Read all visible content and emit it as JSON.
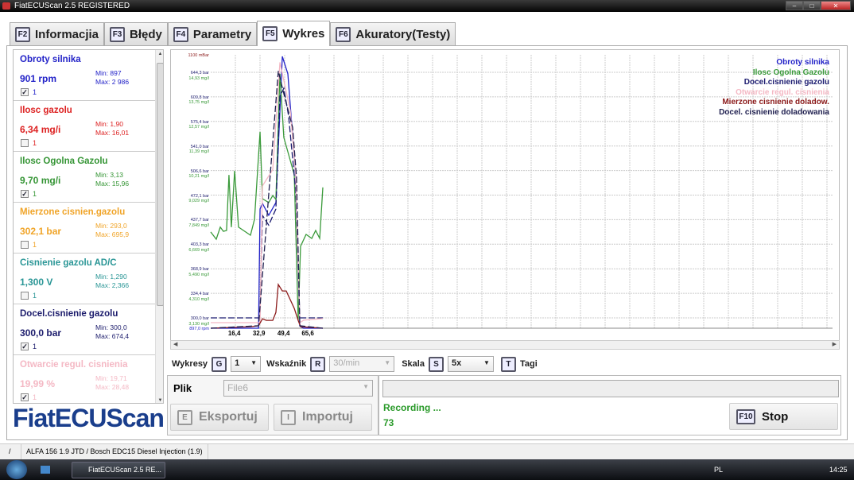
{
  "window": {
    "title": "FiatECUScan 2.5 REGISTERED"
  },
  "tabs": [
    {
      "key": "F2",
      "label": "Informacjia",
      "active": false
    },
    {
      "key": "F3",
      "label": "Błędy",
      "active": false
    },
    {
      "key": "F4",
      "label": "Parametry",
      "active": false
    },
    {
      "key": "F5",
      "label": "Wykres",
      "active": true
    },
    {
      "key": "F6",
      "label": "Akuratory(Testy)",
      "active": false
    }
  ],
  "params": [
    {
      "name": "Obroty silnika",
      "value": "901 rpm",
      "min": "Min: 897",
      "max": "Max: 2 986",
      "checked": true,
      "idx": "1",
      "color": "#2323c8"
    },
    {
      "name": "Ilosc gazolu",
      "value": "6,34 mg/i",
      "min": "Min: 1,90",
      "max": "Max: 16,01",
      "checked": false,
      "idx": "1",
      "color": "#dd2222"
    },
    {
      "name": "Ilosc Ogolna Gazolu",
      "value": "9,70 mg/i",
      "min": "Min: 3,13",
      "max": "Max: 15,96",
      "checked": true,
      "idx": "1",
      "color": "#359535"
    },
    {
      "name": "Mierzone cisnien.gazolu",
      "value": "302,1 bar",
      "min": "Min: 293,0",
      "max": "Max: 695,9",
      "checked": false,
      "idx": "1",
      "color": "#f0a428"
    },
    {
      "name": "Cisnienie gazolu AD/C",
      "value": "1,300 V",
      "min": "Min: 1,290",
      "max": "Max: 2,366",
      "checked": false,
      "idx": "1",
      "color": "#2a9696"
    },
    {
      "name": "Docel.cisnienie gazolu",
      "value": "300,0 bar",
      "min": "Min: 300,0",
      "max": "Max: 674,4",
      "checked": true,
      "idx": "1",
      "color": "#1c1c6c"
    },
    {
      "name": "Otwarcie regul. cisnienia",
      "value": "19,99 %",
      "min": "Min: 19,71",
      "max": "Max: 28,48",
      "checked": true,
      "idx": "1",
      "color": "#f4b8c4"
    }
  ],
  "logo": "FiatECUScan",
  "chart_data": {
    "type": "line",
    "xlim": [
      0,
      415
    ],
    "x_ticks": [
      "16,4",
      "32,9",
      "49,4",
      "65,6"
    ],
    "x_tick_values": [
      16.4,
      32.9,
      49.4,
      65.6
    ],
    "grid": true,
    "legend_position": "top-right",
    "y_labels": [
      [
        "1100 mBar"
      ],
      [
        "644,3 bar",
        "14,93 mg/l"
      ],
      [
        "609,8 bar",
        "13,75 mg/l"
      ],
      [
        "575,4 bar",
        "12,57 mg/l"
      ],
      [
        "541,0 bar",
        "11,39 mg/l"
      ],
      [
        "506,6 bar",
        "10,21 mg/l"
      ],
      [
        "472,1 bar",
        "9,029 mg/l"
      ],
      [
        "437,7 bar",
        "7,849 mg/l"
      ],
      [
        "403,3 bar",
        "6,669 mg/l"
      ],
      [
        "368,9 bar",
        "5,490 mg/l"
      ],
      [
        "334,4 bar",
        "4,310 mg/l"
      ],
      [
        "300,0 bar",
        "3,130 mg/l",
        "897,0 rpm"
      ]
    ],
    "series": [
      {
        "name": "Obroty silnika",
        "color": "#2323c8",
        "unit": "rpm",
        "range": [
          897,
          2986
        ],
        "dash": false,
        "x": [
          0,
          32,
          33,
          34.6,
          38.8,
          43.6,
          47.9,
          51.6,
          56.9,
          59.6,
          62,
          75
        ],
        "y": [
          897,
          897,
          1813,
          1856,
          1765,
          1862,
          2986,
          2852,
          2058,
          915,
          897,
          897
        ]
      },
      {
        "name": "Ilosc Ogolna Gazolu",
        "color": "#3a9a3a",
        "unit": "mg/l",
        "range": [
          3.13,
          14.93
        ],
        "dash": false,
        "x": [
          0,
          3.7,
          6.4,
          8.5,
          10.6,
          12.2,
          13.8,
          16.0,
          18.6,
          26.6,
          29.3,
          33.0,
          34.6,
          38.8,
          41.5,
          43.6,
          46.3,
          48.9,
          51.6,
          55.9,
          56.9,
          58.5,
          60.1,
          63.8,
          67.6,
          70.2,
          72.9,
          75.0
        ],
        "y": [
          7.26,
          6.91,
          7.49,
          7.29,
          7.33,
          10.0,
          7.49,
          10.2,
          7.49,
          7.1,
          7.87,
          12.07,
          8.86,
          8.67,
          9.01,
          8.82,
          14.86,
          11.8,
          11.11,
          10.01,
          7.33,
          3.02,
          6.57,
          7.14,
          6.95,
          7.33,
          6.95,
          9.4
        ]
      },
      {
        "name": "Docel.cisnienie gazolu",
        "color": "#1c1c70",
        "unit": "bar",
        "range": [
          300,
          644.3
        ],
        "dash": true,
        "x": [
          0,
          32.9,
          34.6,
          38.8,
          43.6,
          46.3,
          48.9,
          52.1,
          56.9,
          59.6,
          75
        ],
        "y": [
          300,
          300,
          443.7,
          430,
          452.6,
          610.8,
          622,
          583,
          477,
          300,
          300
        ]
      },
      {
        "name": "Otwarcie regul. cisnienia",
        "color": "#f4b8c4",
        "unit": "%",
        "range": [
          19.71,
          28.48
        ],
        "dash": false,
        "x": [
          0,
          33.0,
          34.6,
          41.5,
          46.3,
          53.2,
          56.9,
          59.6,
          62.2,
          75
        ],
        "y": [
          19.89,
          19.89,
          24.3,
          24.83,
          28.29,
          26.73,
          24.65,
          19.89,
          19.97,
          20.02
        ]
      },
      {
        "name": "Mierzone cisnienie doladow.",
        "color": "#8b1a1a",
        "unit": "mBar",
        "range": [
          0,
          1100
        ],
        "dash": false,
        "x": [
          0,
          26.6,
          32,
          34.6,
          37.2,
          41.5,
          43.6,
          45.2,
          47.9,
          50.5,
          55.9,
          58.5,
          60.1,
          75
        ],
        "y": [
          0,
          6,
          10,
          38,
          32,
          32,
          64,
          177,
          151,
          151,
          80,
          32,
          6,
          0
        ]
      },
      {
        "name": "Docel. cisnienie doladowania",
        "color": "#202050",
        "unit": "mBar",
        "range": [
          0,
          1100
        ],
        "dash": true,
        "x": [
          0,
          32,
          45.2,
          49.4,
          54.8,
          57.4,
          59.6,
          75
        ],
        "y": [
          0,
          10,
          1041,
          937,
          812,
          610,
          10,
          0
        ]
      }
    ]
  },
  "controls": {
    "wykresy_label": "Wykresy",
    "wykresy_key": "G",
    "wykresy_value": "1",
    "wskaznik_label": "Wskaźnik",
    "wskaznik_key": "R",
    "wskaznik_value": "30/min",
    "skala_label": "Skala",
    "skala_key": "S",
    "skala_value": "5x",
    "tagi_key": "T",
    "tagi_label": "Tagi"
  },
  "file": {
    "label": "Plik",
    "value": "File6",
    "export_key": "E",
    "export_label": "Eksportuj",
    "import_key": "I",
    "import_label": "Importuj"
  },
  "recording": {
    "status": "Recording ...",
    "count": "73",
    "stop_key": "F10",
    "stop_label": "Stop"
  },
  "statusbar": {
    "sep": "/",
    "vehicle": "ALFA 156 1.9 JTD / Bosch EDC15 Diesel Injection (1.9)"
  },
  "taskbar": {
    "task": "FiatECUScan 2.5 RE...",
    "lang": "PL",
    "time": "14:25"
  }
}
